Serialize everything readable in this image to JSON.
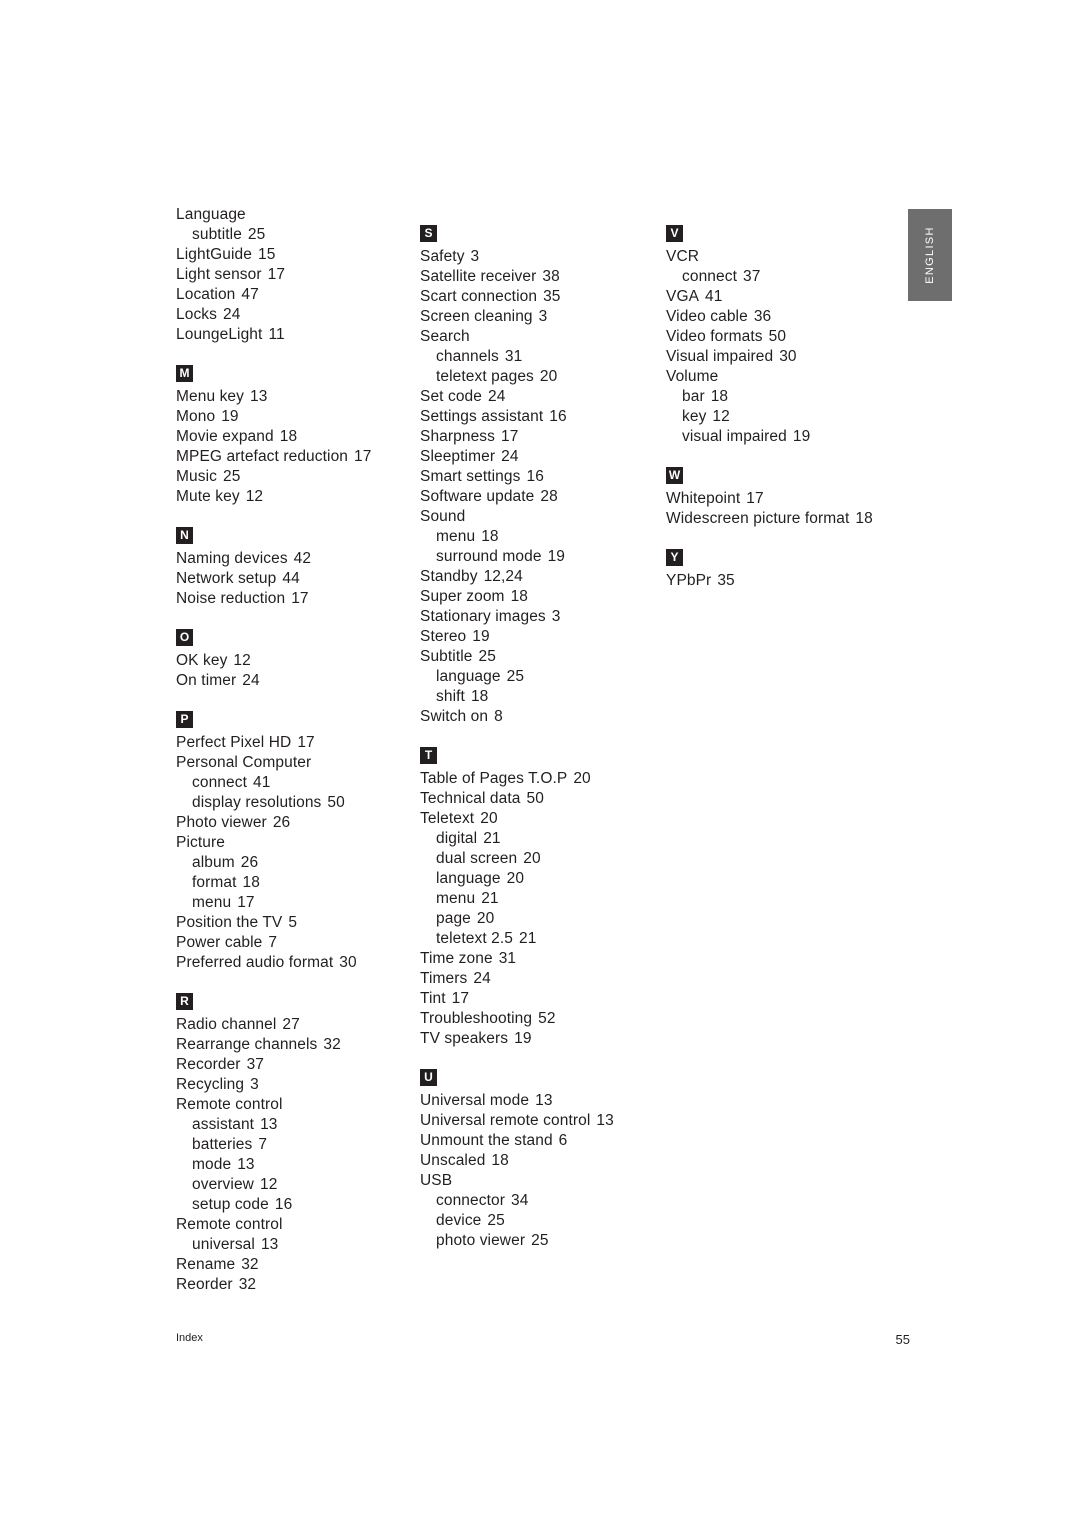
{
  "page": {
    "language_tab": "ENGLISH",
    "footer_label": "Index",
    "page_number": "55"
  },
  "columns": [
    {
      "id": "column-1",
      "groups": [
        {
          "letter": "",
          "entries": [
            {
              "text": "Language",
              "num": "",
              "sub": false
            },
            {
              "text": "subtitle",
              "num": "25",
              "sub": true
            },
            {
              "text": "LightGuide",
              "num": "15",
              "sub": false
            },
            {
              "text": "Light sensor",
              "num": "17",
              "sub": false
            },
            {
              "text": "Location",
              "num": "47",
              "sub": false
            },
            {
              "text": "Locks",
              "num": "24",
              "sub": false
            },
            {
              "text": "LoungeLight",
              "num": "11",
              "sub": false
            }
          ]
        },
        {
          "letter": "M",
          "entries": [
            {
              "text": "Menu key",
              "num": "13",
              "sub": false
            },
            {
              "text": "Mono",
              "num": "19",
              "sub": false
            },
            {
              "text": "Movie expand",
              "num": "18",
              "sub": false
            },
            {
              "text": "MPEG artefact reduction",
              "num": "17",
              "sub": false
            },
            {
              "text": "Music",
              "num": "25",
              "sub": false
            },
            {
              "text": "Mute key",
              "num": "12",
              "sub": false
            }
          ]
        },
        {
          "letter": "N",
          "entries": [
            {
              "text": "Naming devices",
              "num": "42",
              "sub": false
            },
            {
              "text": "Network setup",
              "num": "44",
              "sub": false
            },
            {
              "text": "Noise reduction",
              "num": "17",
              "sub": false
            }
          ]
        },
        {
          "letter": "O",
          "entries": [
            {
              "text": "OK key",
              "num": "12",
              "sub": false
            },
            {
              "text": "On timer",
              "num": "24",
              "sub": false
            }
          ]
        },
        {
          "letter": "P",
          "entries": [
            {
              "text": "Perfect Pixel HD",
              "num": "17",
              "sub": false
            },
            {
              "text": "Personal Computer",
              "num": "",
              "sub": false
            },
            {
              "text": "connect",
              "num": "41",
              "sub": true
            },
            {
              "text": "display resolutions",
              "num": "50",
              "sub": true
            },
            {
              "text": "Photo viewer",
              "num": "26",
              "sub": false
            },
            {
              "text": "Picture",
              "num": "",
              "sub": false
            },
            {
              "text": "album",
              "num": "26",
              "sub": true
            },
            {
              "text": "format",
              "num": "18",
              "sub": true
            },
            {
              "text": "menu",
              "num": "17",
              "sub": true
            },
            {
              "text": "Position the TV",
              "num": "5",
              "sub": false
            },
            {
              "text": "Power cable",
              "num": "7",
              "sub": false
            },
            {
              "text": "Preferred audio format",
              "num": "30",
              "sub": false
            }
          ]
        },
        {
          "letter": "R",
          "entries": [
            {
              "text": "Radio channel",
              "num": "27",
              "sub": false
            },
            {
              "text": "Rearrange channels",
              "num": "32",
              "sub": false
            },
            {
              "text": "Recorder",
              "num": "37",
              "sub": false
            },
            {
              "text": "Recycling",
              "num": "3",
              "sub": false
            },
            {
              "text": "Remote control",
              "num": "",
              "sub": false
            },
            {
              "text": "assistant",
              "num": "13",
              "sub": true
            },
            {
              "text": "batteries",
              "num": "7",
              "sub": true
            },
            {
              "text": "mode",
              "num": "13",
              "sub": true
            },
            {
              "text": "overview",
              "num": "12",
              "sub": true
            },
            {
              "text": "setup code",
              "num": "16",
              "sub": true
            },
            {
              "text": "Remote control",
              "num": "",
              "sub": false
            },
            {
              "text": "universal",
              "num": "13",
              "sub": true
            },
            {
              "text": "Rename",
              "num": "32",
              "sub": false
            },
            {
              "text": "Reorder",
              "num": "32",
              "sub": false
            }
          ]
        }
      ]
    },
    {
      "id": "column-2",
      "groups": [
        {
          "letter": "S",
          "entries": [
            {
              "text": "Safety",
              "num": "3",
              "sub": false
            },
            {
              "text": "Satellite receiver",
              "num": "38",
              "sub": false
            },
            {
              "text": "Scart connection",
              "num": "35",
              "sub": false
            },
            {
              "text": "Screen cleaning",
              "num": "3",
              "sub": false
            },
            {
              "text": "Search",
              "num": "",
              "sub": false
            },
            {
              "text": "channels",
              "num": "31",
              "sub": true
            },
            {
              "text": "teletext pages",
              "num": "20",
              "sub": true
            },
            {
              "text": "Set code",
              "num": "24",
              "sub": false
            },
            {
              "text": "Settings assistant",
              "num": "16",
              "sub": false
            },
            {
              "text": "Sharpness",
              "num": "17",
              "sub": false
            },
            {
              "text": "Sleeptimer",
              "num": "24",
              "sub": false
            },
            {
              "text": "Smart settings",
              "num": "16",
              "sub": false
            },
            {
              "text": "Software update",
              "num": "28",
              "sub": false
            },
            {
              "text": "Sound",
              "num": "",
              "sub": false
            },
            {
              "text": "menu",
              "num": "18",
              "sub": true
            },
            {
              "text": "surround mode",
              "num": "19",
              "sub": true
            },
            {
              "text": "Standby",
              "num": "12,24",
              "sub": false
            },
            {
              "text": "Super zoom",
              "num": "18",
              "sub": false
            },
            {
              "text": "Stationary images",
              "num": "3",
              "sub": false
            },
            {
              "text": "Stereo",
              "num": "19",
              "sub": false
            },
            {
              "text": "Subtitle",
              "num": "25",
              "sub": false
            },
            {
              "text": "language",
              "num": "25",
              "sub": true
            },
            {
              "text": "shift",
              "num": "18",
              "sub": true
            },
            {
              "text": "Switch on",
              "num": "8",
              "sub": false
            }
          ]
        },
        {
          "letter": "T",
          "entries": [
            {
              "text": "Table of Pages T.O.P",
              "num": "20",
              "sub": false
            },
            {
              "text": "Technical data",
              "num": "50",
              "sub": false
            },
            {
              "text": "Teletext",
              "num": "20",
              "sub": false
            },
            {
              "text": "digital",
              "num": "21",
              "sub": true
            },
            {
              "text": "dual screen",
              "num": "20",
              "sub": true
            },
            {
              "text": "language",
              "num": "20",
              "sub": true
            },
            {
              "text": "menu",
              "num": "21",
              "sub": true
            },
            {
              "text": "page",
              "num": "20",
              "sub": true
            },
            {
              "text": "teletext 2.5",
              "num": "21",
              "sub": true
            },
            {
              "text": "Time zone",
              "num": "31",
              "sub": false
            },
            {
              "text": "Timers",
              "num": "24",
              "sub": false
            },
            {
              "text": "Tint",
              "num": "17",
              "sub": false
            },
            {
              "text": "Troubleshooting",
              "num": "52",
              "sub": false
            },
            {
              "text": "TV speakers",
              "num": "19",
              "sub": false
            }
          ]
        },
        {
          "letter": "U",
          "entries": [
            {
              "text": "Universal mode",
              "num": "13",
              "sub": false
            },
            {
              "text": "Universal remote control",
              "num": "13",
              "sub": false
            },
            {
              "text": "Unmount the stand",
              "num": "6",
              "sub": false
            },
            {
              "text": "Unscaled",
              "num": "18",
              "sub": false
            },
            {
              "text": "USB",
              "num": "",
              "sub": false
            },
            {
              "text": "connector",
              "num": "34",
              "sub": true
            },
            {
              "text": "device",
              "num": "25",
              "sub": true
            },
            {
              "text": "photo viewer",
              "num": "25",
              "sub": true
            }
          ]
        }
      ]
    },
    {
      "id": "column-3",
      "groups": [
        {
          "letter": "V",
          "entries": [
            {
              "text": "VCR",
              "num": "",
              "sub": false
            },
            {
              "text": "connect",
              "num": "37",
              "sub": true
            },
            {
              "text": "VGA",
              "num": "41",
              "sub": false
            },
            {
              "text": "Video cable",
              "num": "36",
              "sub": false
            },
            {
              "text": "Video formats",
              "num": "50",
              "sub": false
            },
            {
              "text": "Visual impaired",
              "num": "30",
              "sub": false
            },
            {
              "text": "Volume",
              "num": "",
              "sub": false
            },
            {
              "text": "bar",
              "num": "18",
              "sub": true
            },
            {
              "text": "key",
              "num": "12",
              "sub": true
            },
            {
              "text": "visual impaired",
              "num": "19",
              "sub": true
            }
          ]
        },
        {
          "letter": "W",
          "entries": [
            {
              "text": "Whitepoint",
              "num": "17",
              "sub": false
            },
            {
              "text": "Widescreen picture format",
              "num": "18",
              "sub": false
            }
          ]
        },
        {
          "letter": "Y",
          "entries": [
            {
              "text": "YPbPr",
              "num": "35",
              "sub": false
            }
          ]
        }
      ]
    }
  ]
}
